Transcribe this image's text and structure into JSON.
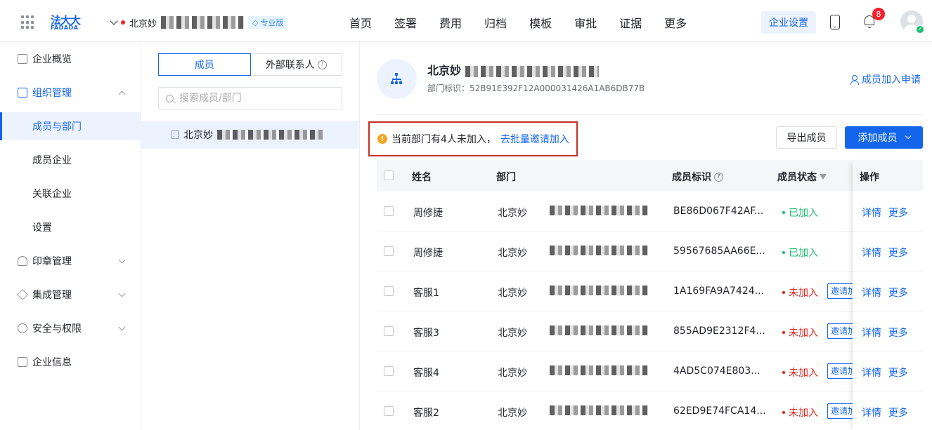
{
  "header": {
    "logo_text": "法大大",
    "logo_sub": "FADADA",
    "company_name_visible": "北京妙",
    "pro_badge": "专业版",
    "nav": [
      "首页",
      "签署",
      "费用",
      "归档",
      "模板",
      "审批",
      "证据",
      "更多"
    ],
    "settings_button": "企业设置",
    "notification_count": "8"
  },
  "sidebar": {
    "items": [
      {
        "label": "企业概览",
        "icon": "overview-icon"
      },
      {
        "label": "组织管理",
        "icon": "org-icon"
      },
      {
        "label": "成员与部门"
      },
      {
        "label": "成员企业"
      },
      {
        "label": "关联企业"
      },
      {
        "label": "设置"
      },
      {
        "label": "印章管理",
        "icon": "seal-icon"
      },
      {
        "label": "集成管理",
        "icon": "layers-icon"
      },
      {
        "label": "安全与权限",
        "icon": "shield-icon"
      },
      {
        "label": "企业信息",
        "icon": "building-icon"
      }
    ]
  },
  "middle": {
    "tabs": [
      "成员",
      "外部联系人"
    ],
    "search_placeholder": "搜索成员/部门",
    "dept_name_visible": "北京妙"
  },
  "main": {
    "dept_title_visible": "北京妙",
    "dept_id_label": "部门标识：",
    "dept_id_value": "52B91E392F12A000031426A1AB6DB77B",
    "join_request_link": "成员加入申请",
    "notice_text": "当前部门有4人未加入，",
    "notice_link": "去批量邀请加入",
    "export_button": "导出成员",
    "add_button": "添加成员",
    "columns": {
      "name": "姓名",
      "dept": "部门",
      "member_id": "成员标识",
      "status": "成员状态",
      "actions": "操作"
    },
    "rows": [
      {
        "name": "周修捷",
        "dept": "北京妙",
        "member_id": "BE86D067F42AF...",
        "status": "已加入",
        "joined": true
      },
      {
        "name": "周修捷",
        "dept": "北京妙",
        "member_id": "59567685AA66E...",
        "status": "已加入",
        "joined": true
      },
      {
        "name": "客服1",
        "dept": "北京妙",
        "member_id": "1A169FA9A7424...",
        "status": "未加入",
        "joined": false
      },
      {
        "name": "客服3",
        "dept": "北京妙",
        "member_id": "855AD9E2312F4...",
        "status": "未加入",
        "joined": false
      },
      {
        "name": "客服4",
        "dept": "北京妙",
        "member_id": "4AD5C074E803...",
        "status": "未加入",
        "joined": false
      },
      {
        "name": "客服2",
        "dept": "北京妙",
        "member_id": "62ED9E74FCA14...",
        "status": "未加入",
        "joined": false
      }
    ],
    "invite_label": "邀请加入",
    "detail_link": "详情",
    "more_link": "更多"
  },
  "colors": {
    "accent": "#1366ec",
    "joined": "#19be6b",
    "not_joined": "#e2231a",
    "highlight_border": "#c92d1f"
  }
}
